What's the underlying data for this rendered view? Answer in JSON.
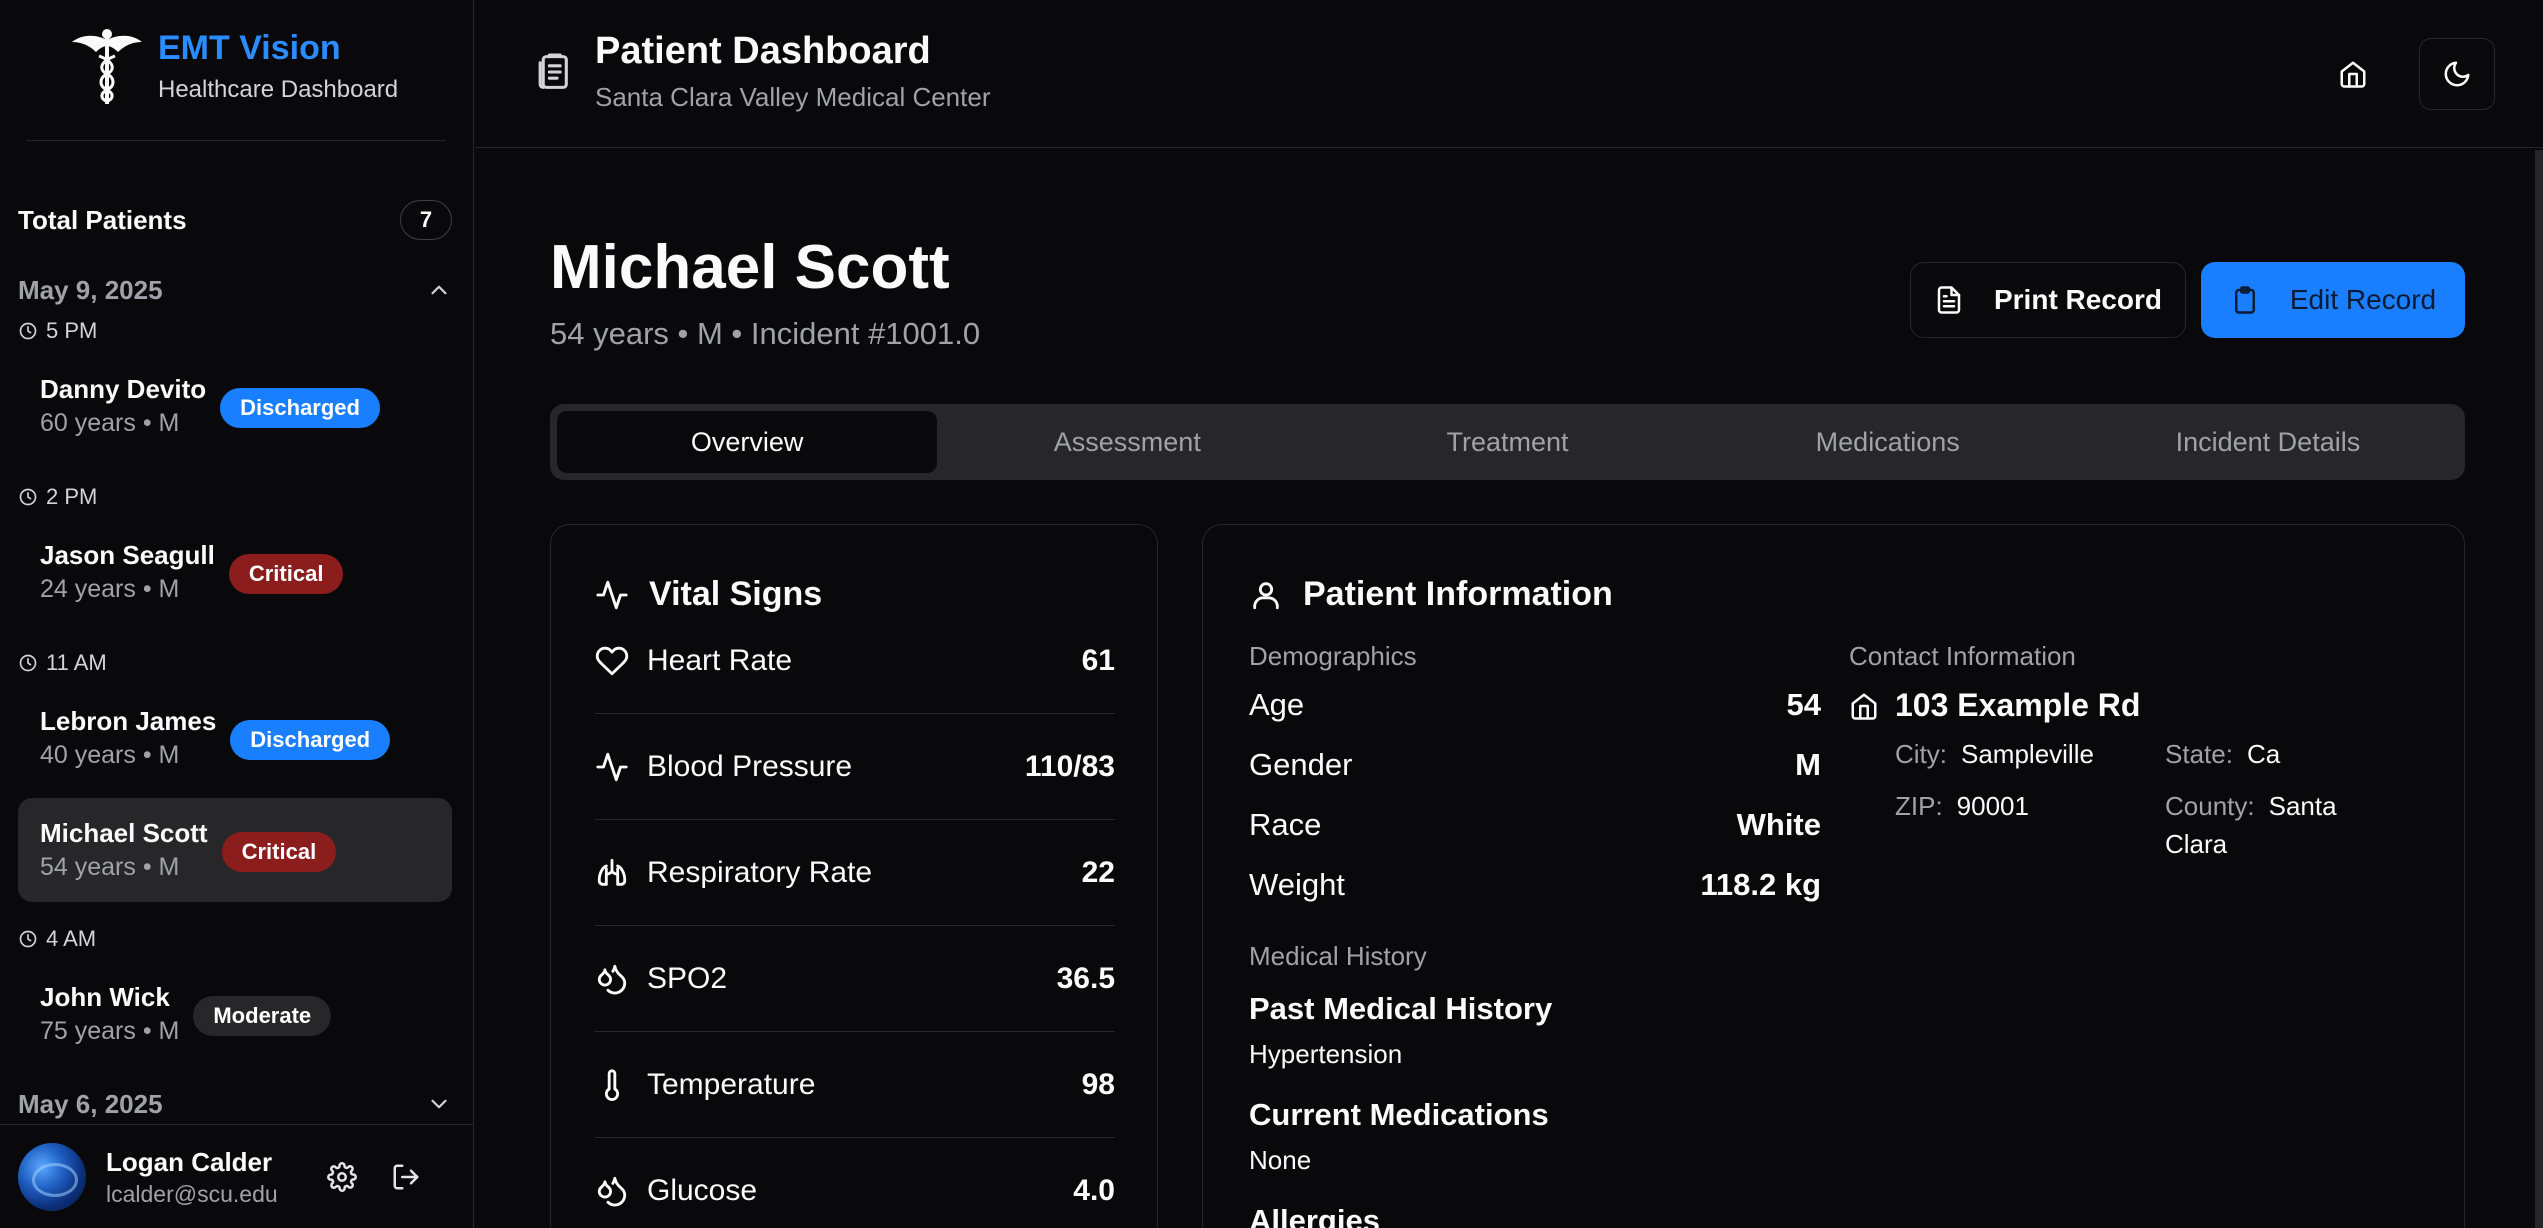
{
  "brand": {
    "title": "EMT Vision",
    "subtitle": "Healthcare Dashboard"
  },
  "sidebar": {
    "total_label": "Total Patients",
    "total_count": "7",
    "groups": [
      {
        "date": "May 9, 2025",
        "expanded": true,
        "entries": [
          {
            "time": "5 PM",
            "name": "Danny Devito",
            "meta": "60 years • M",
            "status": "Discharged"
          },
          {
            "time": "2 PM",
            "name": "Jason Seagull",
            "meta": "24 years • M",
            "status": "Critical"
          },
          {
            "time": "11 AM",
            "name": "Lebron James",
            "meta": "40 years • M",
            "status": "Discharged"
          },
          {
            "time": "",
            "name": "Michael Scott",
            "meta": "54 years • M",
            "status": "Critical",
            "selected": true
          },
          {
            "time": "4 AM",
            "name": "John Wick",
            "meta": "75 years • M",
            "status": "Moderate"
          }
        ]
      },
      {
        "date": "May 6, 2025",
        "expanded": false
      }
    ],
    "user": {
      "name": "Logan Calder",
      "email": "lcalder@scu.edu"
    }
  },
  "topbar": {
    "title": "Patient Dashboard",
    "subtitle": "Santa Clara Valley Medical Center"
  },
  "patient": {
    "name": "Michael Scott",
    "meta": "54 years • M • Incident #1001.0",
    "print_label": "Print Record",
    "edit_label": "Edit Record"
  },
  "tabs": [
    "Overview",
    "Assessment",
    "Treatment",
    "Medications",
    "Incident Details"
  ],
  "active_tab": "Overview",
  "vitals": {
    "title": "Vital Signs",
    "rows": [
      {
        "icon": "heart-icon",
        "label": "Heart Rate",
        "value": "61"
      },
      {
        "icon": "activity-icon",
        "label": "Blood Pressure",
        "value": "110/83"
      },
      {
        "icon": "lungs-icon",
        "label": "Respiratory Rate",
        "value": "22"
      },
      {
        "icon": "droplets-icon",
        "label": "SPO2",
        "value": "36.5"
      },
      {
        "icon": "thermometer-icon",
        "label": "Temperature",
        "value": "98"
      },
      {
        "icon": "droplets-icon",
        "label": "Glucose",
        "value": "4.0"
      }
    ]
  },
  "info": {
    "title": "Patient Information",
    "demographics_label": "Demographics",
    "demographics": [
      {
        "label": "Age",
        "value": "54"
      },
      {
        "label": "Gender",
        "value": "M"
      },
      {
        "label": "Race",
        "value": "White"
      },
      {
        "label": "Weight",
        "value": "118.2 kg"
      }
    ],
    "medical_history_label": "Medical History",
    "history": [
      {
        "title": "Past Medical History",
        "value": "Hypertension"
      },
      {
        "title": "Current Medications",
        "value": "None"
      },
      {
        "title": "Allergies",
        "value": ""
      }
    ],
    "contact_label": "Contact Information",
    "address": "103 Example Rd",
    "city_label": "City:",
    "city": "Sampleville",
    "state_label": "State:",
    "state": "Ca",
    "zip_label": "ZIP:",
    "zip": "90001",
    "county_label": "County:",
    "county": "Santa Clara"
  },
  "colors": {
    "accent": "#1a7fff",
    "critical": "#8b1d1d",
    "moderate": "#27272a",
    "background": "#09090b"
  }
}
